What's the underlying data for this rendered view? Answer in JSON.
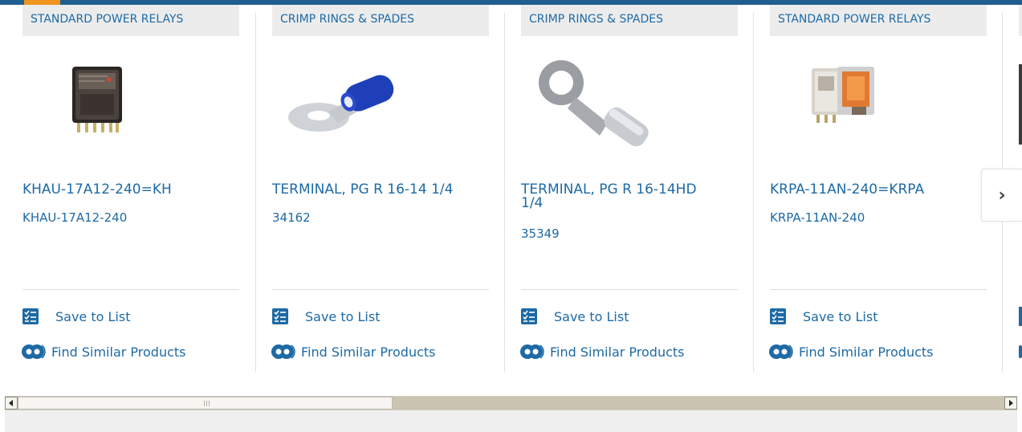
{
  "colors": {
    "link_blue": "#1d6aa5",
    "top_bar": "#1f5f8f",
    "top_accent": "#f0951e",
    "category_bg": "#ececec"
  },
  "products": [
    {
      "category": "STANDARD POWER RELAYS",
      "title": "KHAU-17A12-240=KH",
      "part_number": "KHAU-17A12-240",
      "image": "relay-khau-icon",
      "save_label": "Save to List",
      "similar_label": "Find Similar Products"
    },
    {
      "category": "CRIMP RINGS & SPADES",
      "title": "TERMINAL, PG R 16-14 1/4",
      "part_number": "34162",
      "image": "insulated-ring-terminal-icon",
      "save_label": "Save to List",
      "similar_label": "Find Similar Products"
    },
    {
      "category": "CRIMP RINGS & SPADES",
      "title": "TERMINAL, PG R 16-14HD 1/4",
      "title_line1": "TERMINAL, PG R 16-14HD",
      "title_line2": "1/4",
      "part_number": "35349",
      "image": "bare-ring-terminal-icon",
      "save_label": "Save to List",
      "similar_label": "Find Similar Products"
    },
    {
      "category": "STANDARD POWER RELAYS",
      "title": "KRPA-11AN-240=KRPA",
      "part_number": "KRPA-11AN-240",
      "image": "relay-krpa-icon",
      "save_label": "Save to List",
      "similar_label": "Find Similar Products"
    }
  ],
  "next_button": {
    "icon": "chevron-right-icon",
    "glyph": "›"
  },
  "scrollbar": {
    "left_icon": "scroll-left-arrow-icon",
    "right_icon": "scroll-right-arrow-icon",
    "position_fraction": 0.0
  }
}
